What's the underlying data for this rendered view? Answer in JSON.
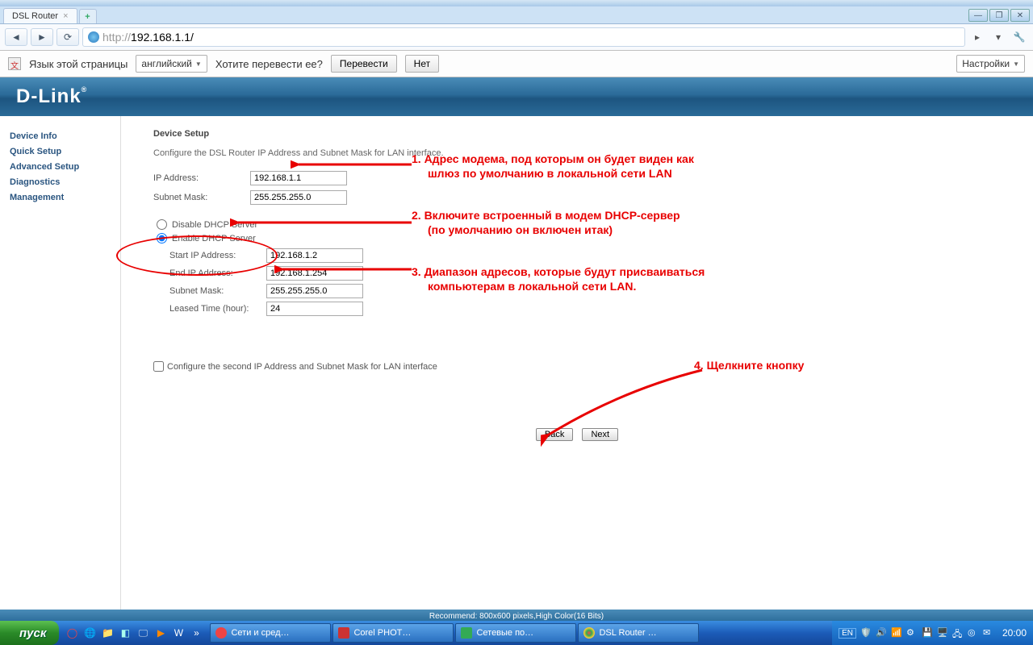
{
  "browser": {
    "tab_title": "DSL Router",
    "url_grey": "http://",
    "url_black": "192.168.1.1/",
    "new_tab": "+"
  },
  "translate": {
    "prompt1": "Язык этой страницы",
    "language": "английский",
    "prompt2": "Хотите перевести ее?",
    "btn_yes": "Перевести",
    "btn_no": "Нет",
    "settings": "Настройки"
  },
  "brand": "D-Link",
  "sidebar": {
    "items": [
      "Device Info",
      "Quick Setup",
      "Advanced Setup",
      "Diagnostics",
      "Management"
    ]
  },
  "page": {
    "title": "Device Setup",
    "desc": "Configure the DSL Router IP Address and Subnet Mask for LAN interface.",
    "ip_label": "IP Address:",
    "ip_value": "192.168.1.1",
    "mask_label": "Subnet Mask:",
    "mask_value": "255.255.255.0",
    "dhcp_disable": "Disable DHCP Server",
    "dhcp_enable": "Enable DHCP Server",
    "start_ip_label": "Start IP Address:",
    "start_ip_value": "192.168.1.2",
    "end_ip_label": "End IP Address:",
    "end_ip_value": "192.168.1.254",
    "sub_mask_label": "Subnet Mask:",
    "sub_mask_value": "255.255.255.0",
    "leased_label": "Leased Time (hour):",
    "leased_value": "24",
    "second_ip": "Configure the second IP Address and Subnet Mask for LAN interface",
    "btn_back": "Back",
    "btn_next": "Next"
  },
  "annotations": {
    "a1_l1": "1. Адрес модема, под которым он будет виден как",
    "a1_l2": "шлюз по умолчанию  в локальной сети LAN",
    "a2_l1": "2. Включите встроенный в модем DHCP-сервер",
    "a2_l2": "(по умолчанию он включен итак)",
    "a3_l1": "3. Диапазон адресов, которые будут присваиваться",
    "a3_l2": "компьютерам в локальной сети LAN.",
    "a4": "4. Щелкните кнопку"
  },
  "statusbar": "Recommend: 800x600 pixels,High Color(16 Bits)",
  "taskbar": {
    "start": "пуск",
    "tasks": [
      "Сети и сред…",
      "Corel PHOT…",
      "Сетевые по…",
      "DSL Router …"
    ],
    "lang": "EN",
    "clock": "20:00"
  }
}
